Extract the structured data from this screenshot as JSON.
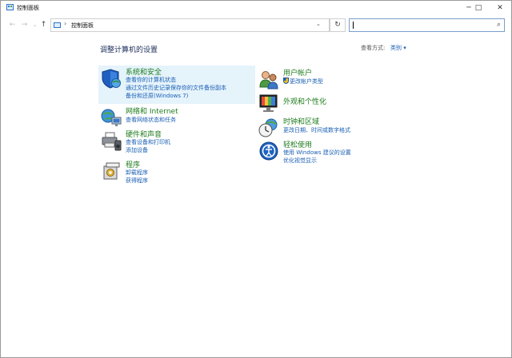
{
  "window": {
    "title": "控制面板"
  },
  "titlebar": {
    "minimize": "─",
    "maximize": "□",
    "close": "✕"
  },
  "nav": {
    "back": "←",
    "forward": "→",
    "recent": "⌄",
    "up": "↑"
  },
  "address": {
    "separator": "›",
    "path": "控制面板",
    "dropdown": "⌄"
  },
  "refresh": "↻",
  "search": {
    "placeholder": "",
    "icon": "⌕"
  },
  "page": {
    "title": "调整计算机的设置",
    "view_by_label": "查看方式:",
    "view_by_value": "类别 ▾"
  },
  "categories_left": [
    {
      "title": "系统和安全",
      "icon": "shield-globe-icon",
      "links": [
        "查看你的计算机状态",
        "通过文件历史记录保存你的文件备份副本",
        "备份和还原(Windows 7)"
      ]
    },
    {
      "title": "网络和 Internet",
      "icon": "network-globe-icon",
      "links": [
        "查看网络状态和任务"
      ]
    },
    {
      "title": "硬件和声音",
      "icon": "printer-speaker-icon",
      "links": [
        "查看设备和打印机",
        "添加设备"
      ]
    },
    {
      "title": "程序",
      "icon": "program-box-icon",
      "links": [
        "卸载程序",
        "获得程序"
      ]
    }
  ],
  "categories_right": [
    {
      "title": "用户帐户",
      "icon": "users-icon",
      "links": [
        "更改帐户类型"
      ]
    },
    {
      "title": "外观和个性化",
      "icon": "display-palette-icon",
      "links": []
    },
    {
      "title": "时钟和区域",
      "icon": "clock-globe-icon",
      "links": [
        "更改日期、时间或数字格式"
      ]
    },
    {
      "title": "轻松使用",
      "icon": "ease-of-access-icon",
      "links": [
        "使用 Windows 建议的设置",
        "优化视觉显示"
      ]
    }
  ],
  "colors": {
    "title_green": "#1d7b1d",
    "link_blue": "#1a5fb4",
    "header_navy": "#1b2d59",
    "hover_bg": "#e5f3fb"
  }
}
